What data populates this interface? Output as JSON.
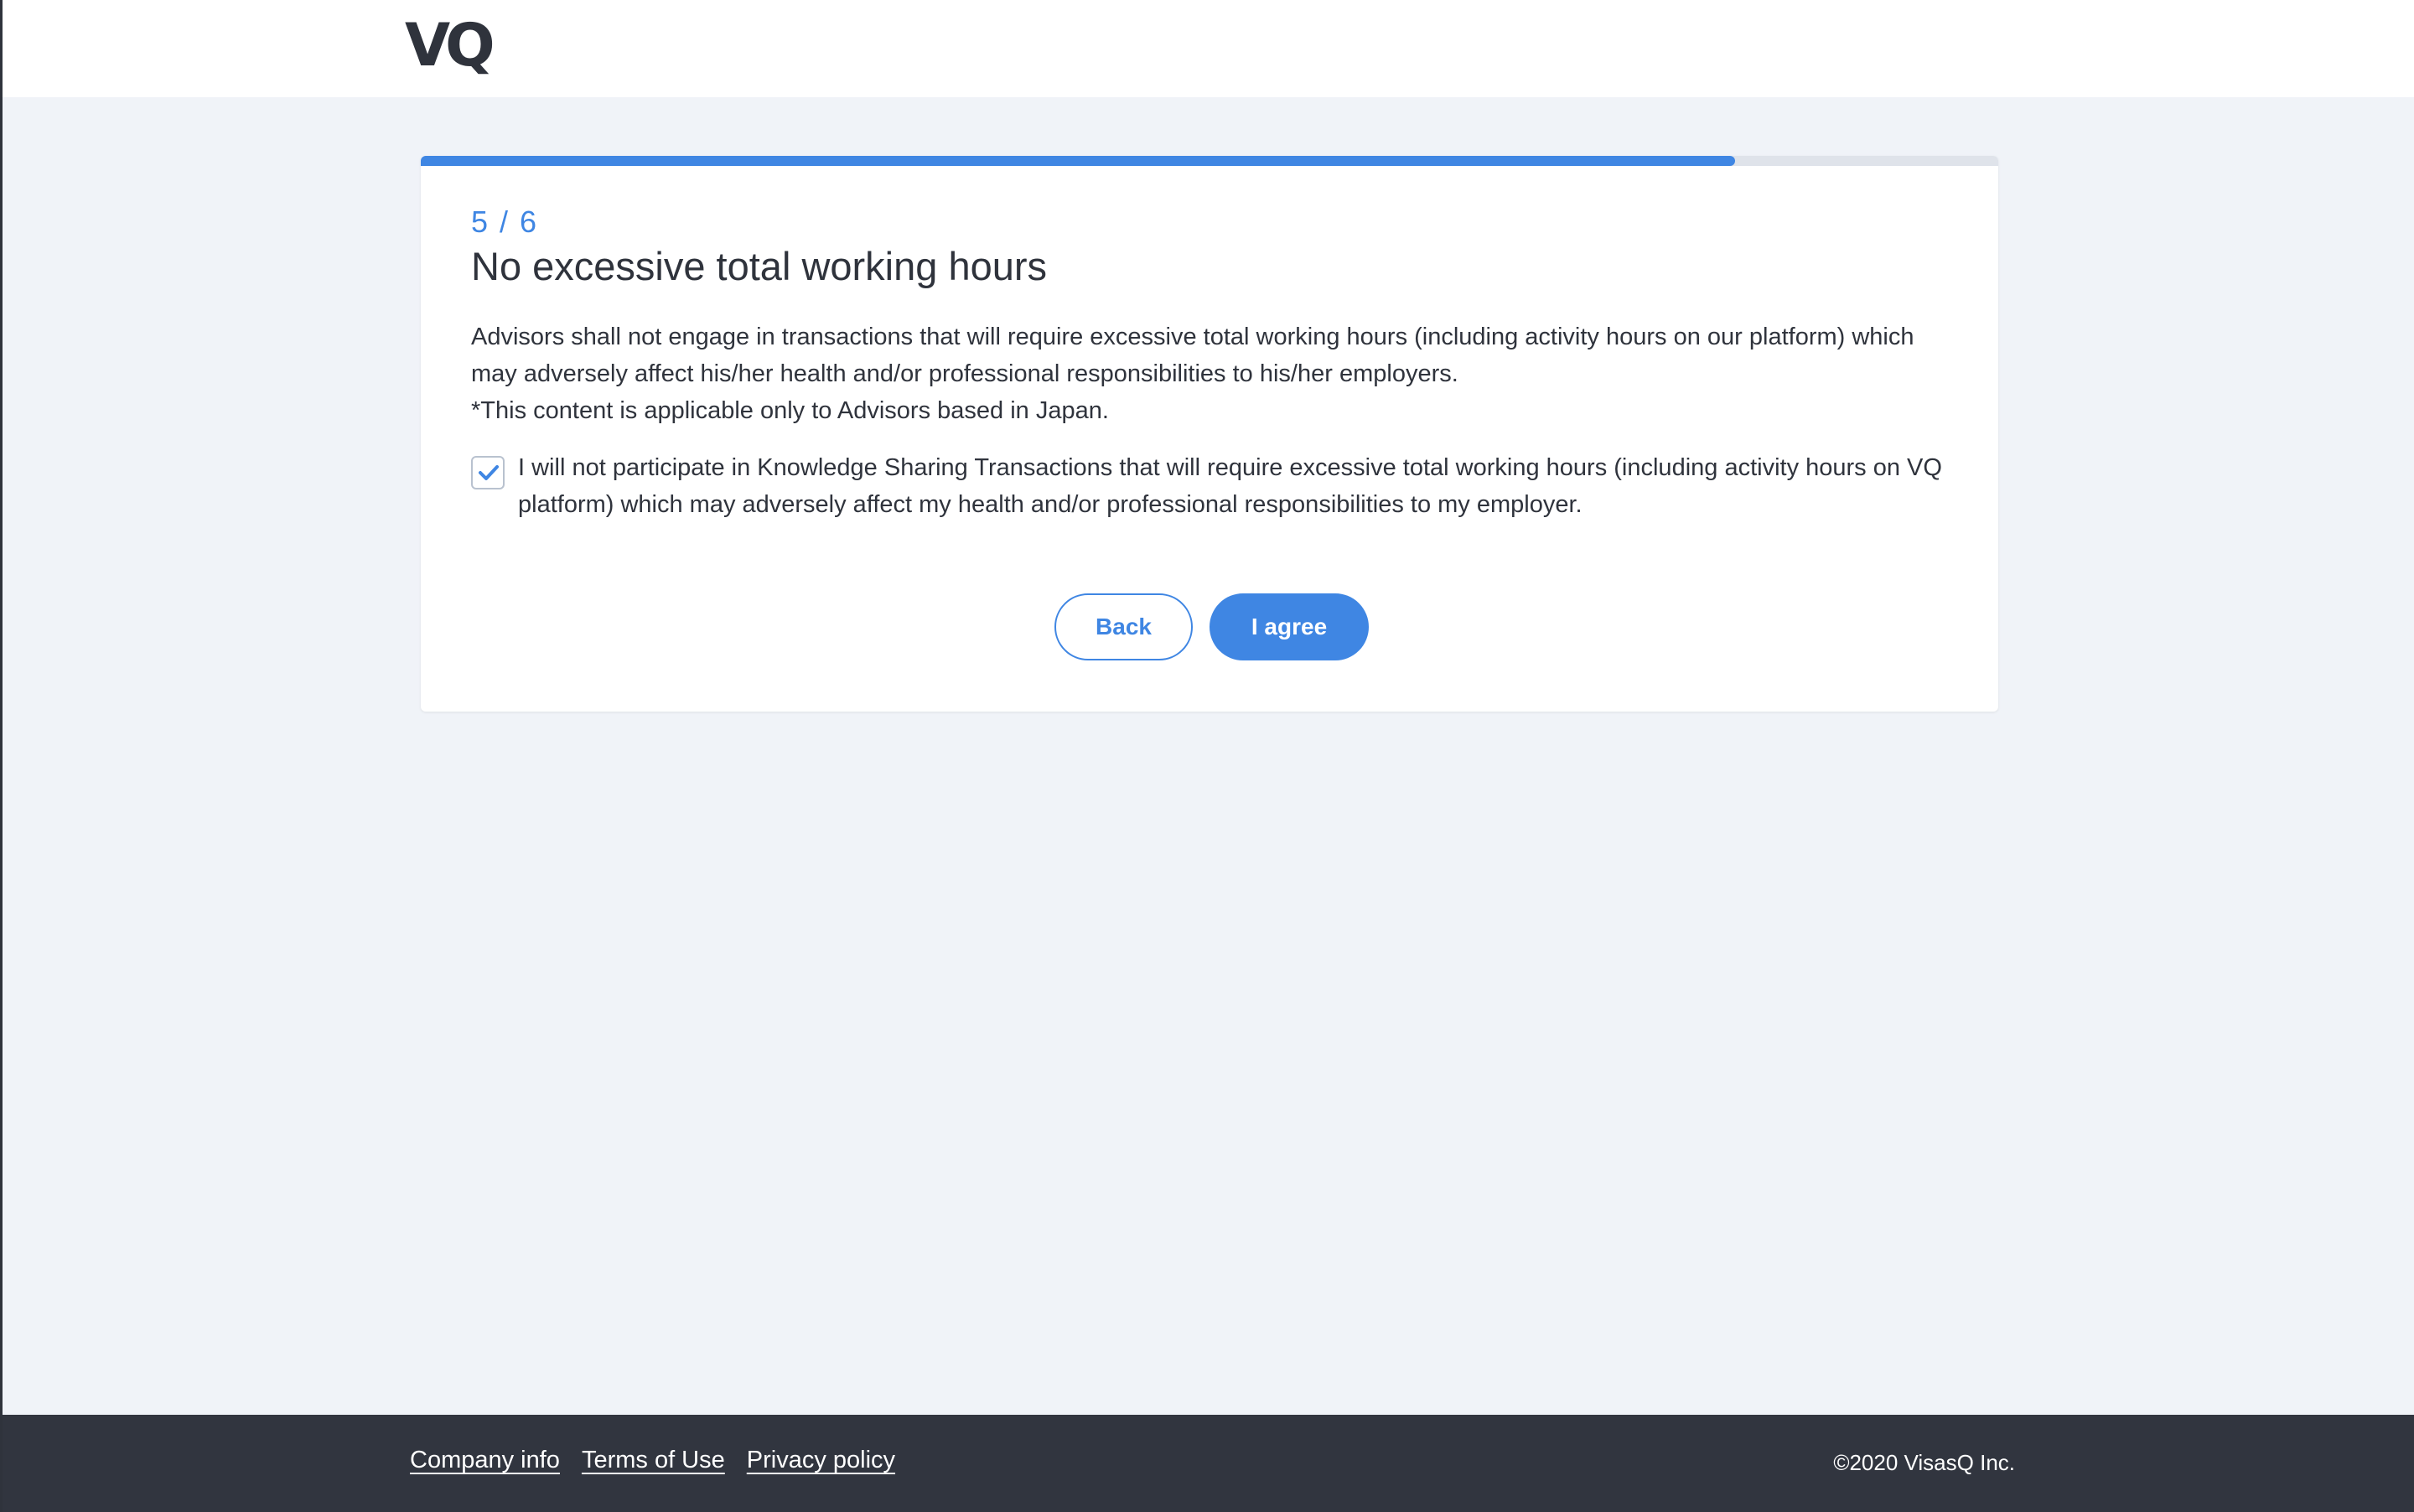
{
  "header": {
    "logo_text": "VQ"
  },
  "progress": {
    "current_step": 5,
    "total_steps": 6,
    "fraction": 0.833
  },
  "card": {
    "step_label": "5 / 6",
    "title": "No excessive total working hours",
    "description_line1": "Advisors shall not engage in transactions that will require excessive total working hours (including activity hours on our platform) which may adversely affect his/her health and/or professional responsibilities to his/her employers.",
    "description_line2": "*This content is applicable only to Advisors based in Japan.",
    "checkbox": {
      "checked": true,
      "label": "I will not participate in Knowledge Sharing Transactions that will require excessive total working hours (including activity hours on VQ platform) which may adversely affect my health and/or professional responsibilities to my employer."
    },
    "back_label": "Back",
    "agree_label": "I agree"
  },
  "footer": {
    "links": [
      "Company info",
      "Terms of Use",
      "Privacy policy"
    ],
    "copyright": "©2020 VisasQ Inc."
  },
  "colors": {
    "accent": "#3f86e3",
    "background": "#f0f3f8",
    "footer_bg": "#31353f",
    "text": "#2f333c"
  },
  "icons": {
    "checkbox_mark": "checkmark-icon"
  }
}
